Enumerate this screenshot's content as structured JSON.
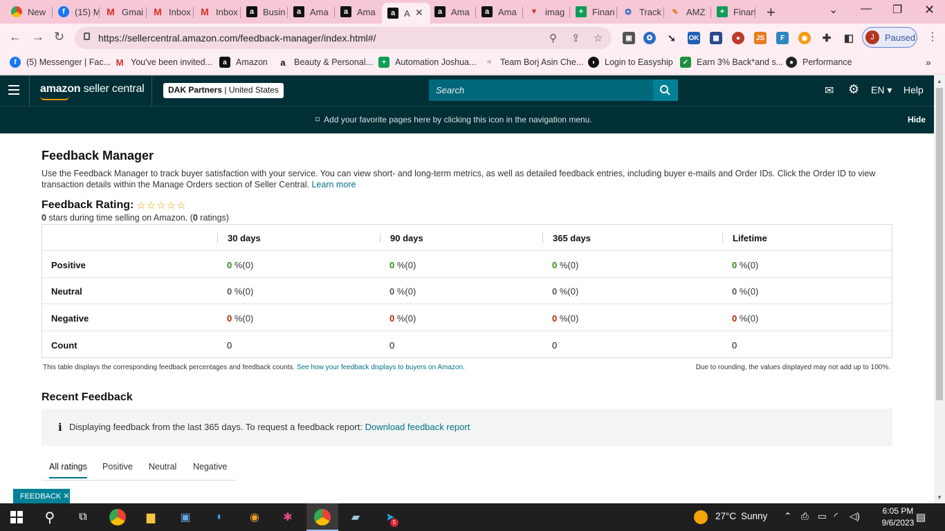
{
  "browser": {
    "tabs": [
      {
        "label": "New",
        "icon": "chrome-icon"
      },
      {
        "label": "(15) M",
        "icon": "facebook-icon"
      },
      {
        "label": "Gmai",
        "icon": "gmail-icon"
      },
      {
        "label": "Inbox",
        "icon": "gmail-icon"
      },
      {
        "label": "Inbox",
        "icon": "gmail-icon"
      },
      {
        "label": "Busin",
        "icon": "amazon-icon"
      },
      {
        "label": "Ama",
        "icon": "amazon-icon"
      },
      {
        "label": "Ama",
        "icon": "amazon-icon"
      },
      {
        "label": "A",
        "icon": "amazon-icon",
        "active": true
      },
      {
        "label": "Ama",
        "icon": "amazon-icon"
      },
      {
        "label": "Ama",
        "icon": "amazon-icon"
      },
      {
        "label": "imag",
        "icon": "triangle-icon"
      },
      {
        "label": "Finan",
        "icon": "sheets-icon"
      },
      {
        "label": "Track",
        "icon": "track-icon"
      },
      {
        "label": "AMZ",
        "icon": "pencil-icon"
      },
      {
        "label": "Finan",
        "icon": "sheets-icon"
      }
    ],
    "url": "https://sellercentral.amazon.com/feedback-manager/index.html#/",
    "profile_status": "Paused",
    "profile_initial": "J",
    "bookmarks": [
      {
        "label": "(5) Messenger | Fac...",
        "icon": "facebook-icon"
      },
      {
        "label": "You've been invited...",
        "icon": "gmail-icon"
      },
      {
        "label": "Amazon",
        "icon": "amazon-icon"
      },
      {
        "label": "Beauty & Personal...",
        "icon": "amazon-smile-icon"
      },
      {
        "label": "Automation Joshua...",
        "icon": "sheets-icon"
      },
      {
        "label": "Team Borj Asin Che...",
        "icon": "wave-icon"
      },
      {
        "label": "Login to Easyship",
        "icon": "easyship-icon"
      },
      {
        "label": "Earn 3% Back*and s...",
        "icon": "cashback-icon"
      },
      {
        "label": "Performance",
        "icon": "github-icon"
      }
    ]
  },
  "header": {
    "logo_bold": "amazon",
    "logo_rest": " seller central",
    "account_name": "DAK Partners",
    "account_region": "United States",
    "search_placeholder": "Search",
    "language": "EN",
    "help": "Help"
  },
  "favorites_bar": {
    "message": "Add your favorite pages here by clicking this icon in the navigation menu.",
    "hide": "Hide"
  },
  "page": {
    "title": "Feedback Manager",
    "intro": "Use the Feedback Manager to track buyer satisfaction with your service. You can view short- and long-term metrics, as well as detailed feedback entries, including buyer e-mails and Order IDs. Click the Order ID to view transaction details within the Manage Orders section of Seller Central.",
    "learn_more": "Learn more",
    "rating_label": "Feedback Rating:",
    "stars": "☆☆☆☆☆",
    "stars_value": "0",
    "stars_text": " stars during time selling on Amazon. (",
    "ratings_value": "0",
    "ratings_text": " ratings)"
  },
  "feedback_table": {
    "columns": [
      "30 days",
      "90 days",
      "365 days",
      "Lifetime"
    ],
    "rows": [
      {
        "label": "Positive",
        "cells": [
          {
            "v": "0",
            "s": " %(0)"
          },
          {
            "v": "0",
            "s": " %(0)"
          },
          {
            "v": "0",
            "s": " %(0)"
          },
          {
            "v": "0",
            "s": " %(0)"
          }
        ]
      },
      {
        "label": "Neutral",
        "cells": [
          {
            "v": "0",
            "s": " %(0)"
          },
          {
            "v": "0",
            "s": " %(0)"
          },
          {
            "v": "0",
            "s": " %(0)"
          },
          {
            "v": "0",
            "s": " %(0)"
          }
        ]
      },
      {
        "label": "Negative",
        "cells": [
          {
            "v": "0",
            "s": " %(0)"
          },
          {
            "v": "0",
            "s": " %(0)"
          },
          {
            "v": "0",
            "s": " %(0)"
          },
          {
            "v": "0",
            "s": " %(0)"
          }
        ]
      },
      {
        "label": "Count",
        "cells": [
          "0",
          "0",
          "0",
          "0"
        ]
      }
    ],
    "note": "This table displays the corresponding feedback percentages and feedback counts.",
    "note_link": "See how your feedback displays to buyers on Amazon.",
    "rounding_note": "Due to rounding, the values displayed may not add up to 100%."
  },
  "recent": {
    "title": "Recent Feedback",
    "info_text": "Displaying feedback from the last 365 days. To request a feedback report:",
    "info_link": "Download feedback report",
    "tabs": [
      "All ratings",
      "Positive",
      "Neutral",
      "Negative"
    ],
    "feedback_button": "FEEDBACK"
  },
  "taskbar": {
    "temperature": "27°C",
    "weather": "Sunny",
    "time": "6:05 PM",
    "date": "9/6/2023",
    "badge": "5"
  },
  "colors": {
    "tabstrip": "#f6c7d6",
    "header": "#002f36",
    "link": "#007185",
    "positive": "#2e8b17",
    "negative": "#b12704",
    "star": "#e89a00"
  }
}
